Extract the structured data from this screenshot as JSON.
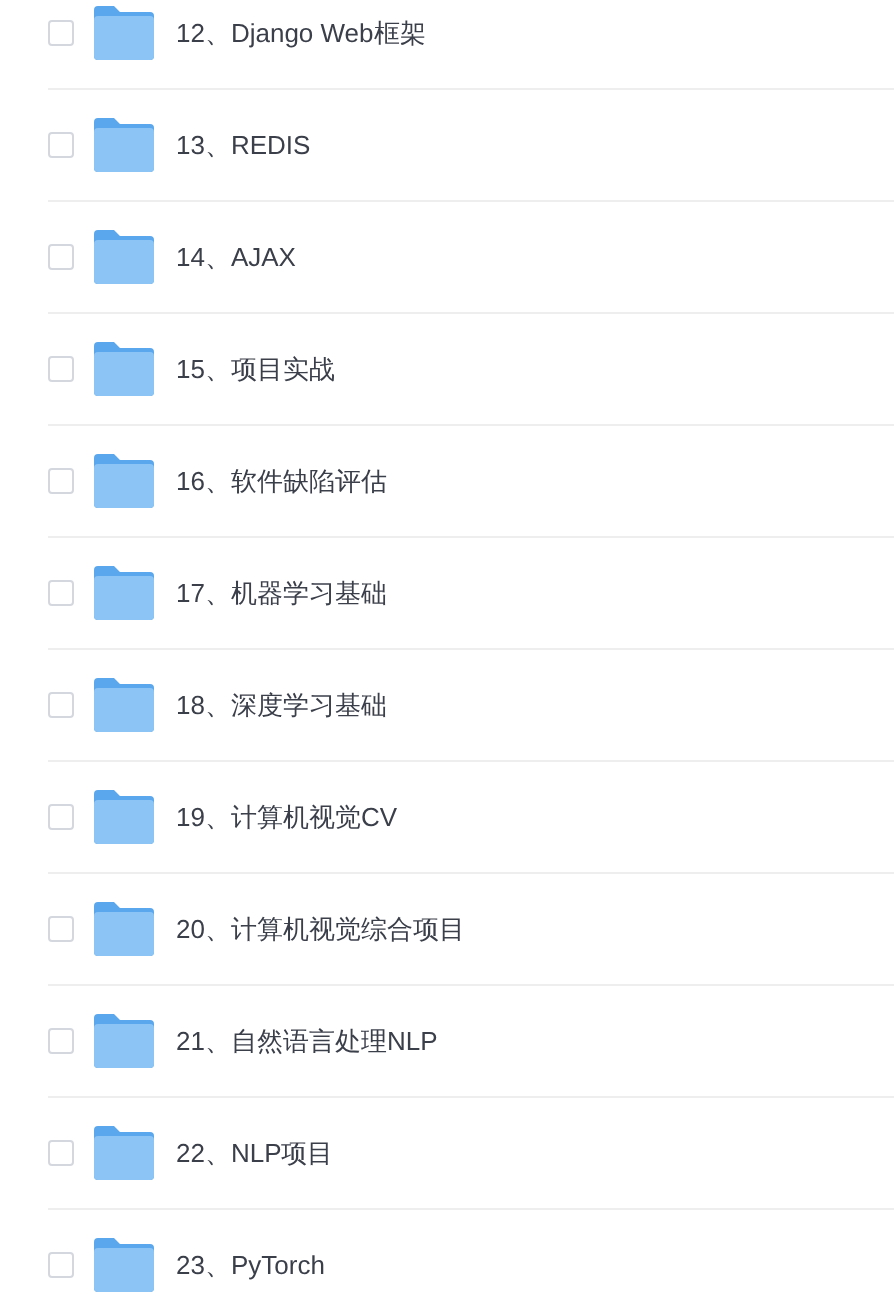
{
  "files": [
    {
      "name": "12、Django Web框架",
      "checked": false
    },
    {
      "name": "13、REDIS",
      "checked": false
    },
    {
      "name": "14、AJAX",
      "checked": false
    },
    {
      "name": "15、项目实战",
      "checked": false
    },
    {
      "name": "16、软件缺陷评估",
      "checked": false
    },
    {
      "name": "17、机器学习基础",
      "checked": false
    },
    {
      "name": "18、深度学习基础",
      "checked": false
    },
    {
      "name": "19、计算机视觉CV",
      "checked": false
    },
    {
      "name": "20、计算机视觉综合项目",
      "checked": false
    },
    {
      "name": "21、自然语言处理NLP",
      "checked": false
    },
    {
      "name": "22、NLP项目",
      "checked": false
    },
    {
      "name": "23、PyTorch",
      "checked": false
    }
  ]
}
